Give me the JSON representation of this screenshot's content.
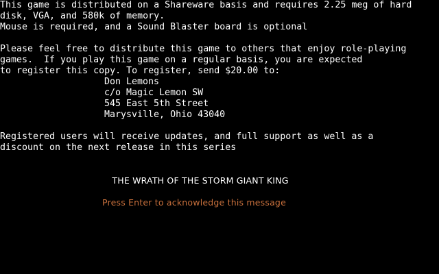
{
  "message": {
    "para1": [
      "This game is distributed on a Shareware basis and requires 2.25 meg of hard",
      "disk, VGA, and 580k of memory.",
      "Mouse is required, and a Sound Blaster board is optional"
    ],
    "para2": [
      "Please feel free to distribute this game to others that enjoy role-playing",
      "games.  If you play this game on a regular basis, you are expected",
      "to register this copy. To register, send $20.00 to:"
    ],
    "address": [
      "Don Lemons",
      "c/o Magic Lemon SW",
      "545 East 5th Street",
      "Marysville, Ohio 43040"
    ],
    "para3": [
      "Registered users will receive updates, and full support as well as a",
      "discount on the next release in this series"
    ]
  },
  "game_title": "THE WRATH OF THE STORM GIANT KING",
  "prompt": "Press Enter to acknowledge this message",
  "colors": {
    "background": "#000000",
    "text": "#ffffff",
    "prompt": "#c8703c"
  }
}
